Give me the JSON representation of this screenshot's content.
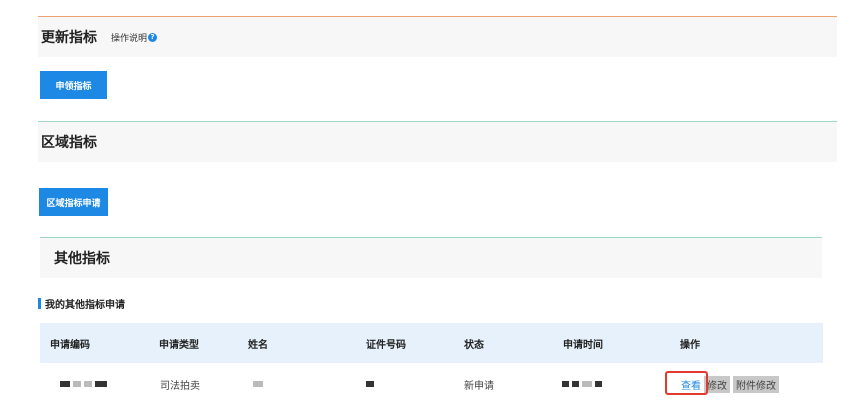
{
  "sections": {
    "update": {
      "title": "更新指标",
      "help_label": "操作说明",
      "help_icon": "question-icon",
      "button": "申领指标"
    },
    "region": {
      "title": "区域指标",
      "button": "区域指标申请"
    },
    "other": {
      "title": "其他指标",
      "subtitle": "我的其他指标申请"
    }
  },
  "table": {
    "headers": [
      "申请编码",
      "申请类型",
      "姓名",
      "证件号码",
      "状态",
      "申请时间",
      "操作"
    ],
    "rows": [
      {
        "type": "司法拍卖",
        "status": "新申请"
      }
    ],
    "actions": {
      "view": "查看",
      "edit": "修改",
      "attach_edit": "附件修改"
    }
  },
  "colors": {
    "accent": "#1e88e5",
    "top_border": "#f0a070",
    "section_divider": "#9fd9c4",
    "highlight": "#e23a2f"
  }
}
